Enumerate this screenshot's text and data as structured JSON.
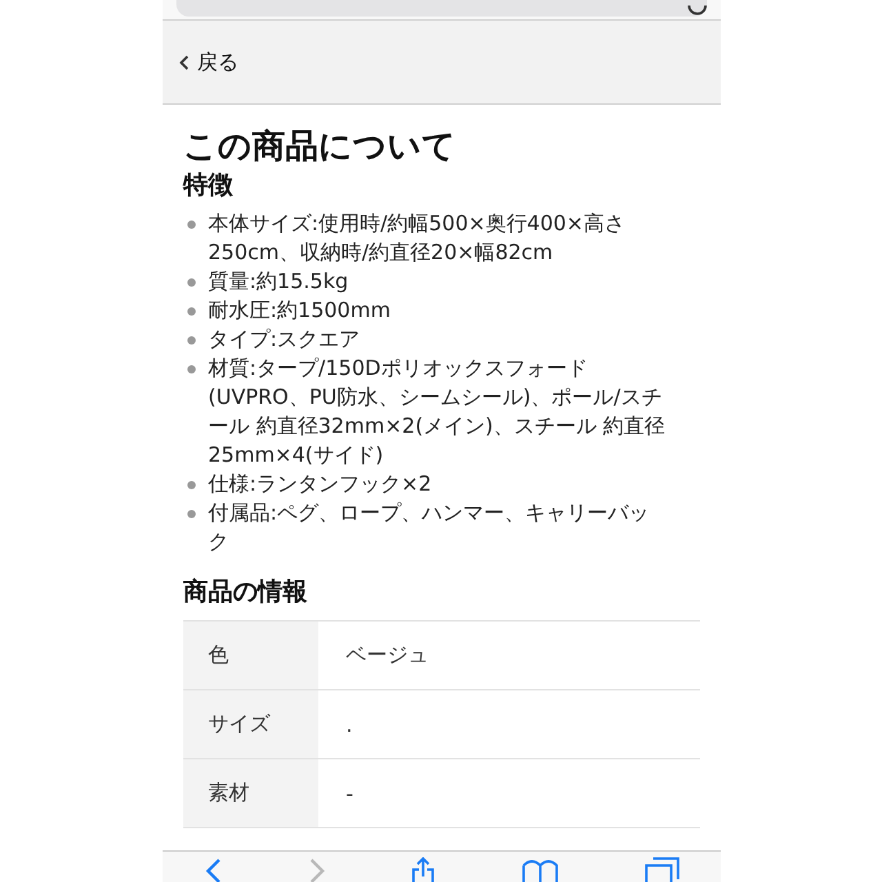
{
  "nav": {
    "back_label": "戻る"
  },
  "section": {
    "title": "この商品について",
    "features_heading": "特徴",
    "features": [
      "本体サイズ:使用時/約幅500×奥行400×高さ250cm、収納時/約直径20×幅82cm",
      "質量:約15.5kg",
      "耐水圧:約1500mm",
      "タイプ:スクエア",
      "材質:タープ/150Dポリオックスフォード(UVPRO、PU防水、シームシール)、ポール/スチール 約直径32mm×2(メイン)、スチール 約直径25mm×4(サイド)",
      "仕様:ランタンフック×2",
      "付属品:ペグ、ロープ、ハンマー、キャリーバック"
    ]
  },
  "info": {
    "heading": "商品の情報",
    "rows": [
      {
        "label": "色",
        "value": "ベージュ"
      },
      {
        "label": "サイズ",
        "value": "."
      },
      {
        "label": "素材",
        "value": "-"
      }
    ]
  },
  "toolbar": {
    "items": [
      {
        "kind": "back",
        "disabled": false
      },
      {
        "kind": "forward",
        "disabled": true
      },
      {
        "kind": "share",
        "disabled": false
      },
      {
        "kind": "bookmarks",
        "disabled": false
      },
      {
        "kind": "tabs",
        "disabled": false
      }
    ]
  }
}
